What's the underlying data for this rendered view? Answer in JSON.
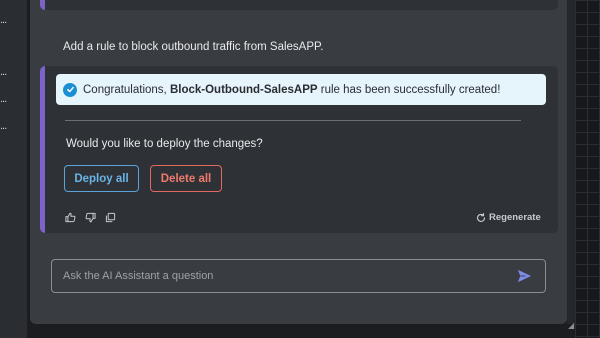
{
  "sidebar": {
    "ellipses": [
      "...",
      "...",
      "...",
      "..."
    ]
  },
  "chat": {
    "user_message": "Add a rule to block outbound traffic from SalesAPP.",
    "success": {
      "prefix": "Congratulations, ",
      "rule_name": "Block-Outbound-SalesAPP",
      "suffix": " rule has been successfully created!"
    },
    "question": "Would you like to deploy the changes?",
    "deploy_label": "Deploy all",
    "delete_label": "Delete all",
    "regenerate_label": "Regenerate"
  },
  "input": {
    "placeholder": "Ask the AI Assistant a question"
  },
  "colors": {
    "accent": "#7b63c7",
    "deploy": "#6ab4e6",
    "delete": "#ee7a6c",
    "check": "#1a8fd6",
    "send": "#7e8ee8"
  },
  "icons": [
    "check-circle-icon",
    "thumbs-up-icon",
    "thumbs-down-icon",
    "copy-icon",
    "refresh-icon",
    "send-icon"
  ]
}
